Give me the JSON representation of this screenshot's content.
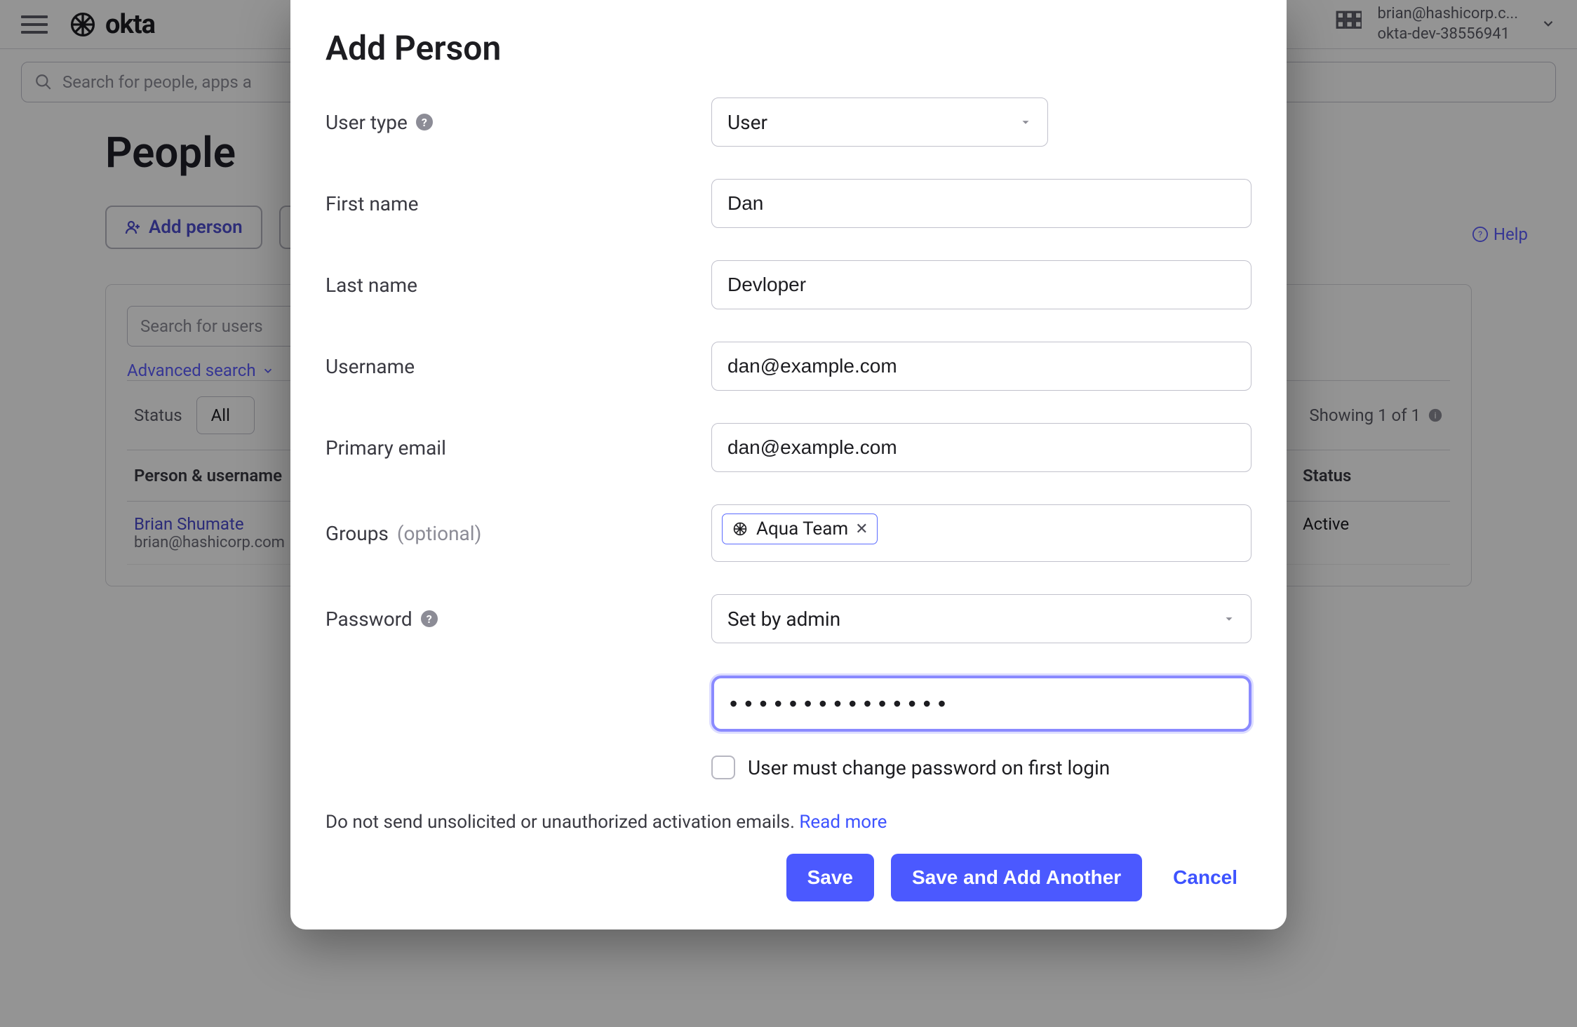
{
  "header": {
    "brand": "okta",
    "search_placeholder": "Search for people, apps a",
    "user_email_top": "brian@hashicorp.c...",
    "org_name": "okta-dev-38556941"
  },
  "page": {
    "title": "People",
    "help_label": "Help",
    "toolbar": {
      "add_person_label": "Add person"
    },
    "panel": {
      "search_placeholder": "Search for users",
      "advanced_search_label": "Advanced search",
      "status_label": "Status",
      "status_value": "All",
      "showing_text": "Showing 1 of 1",
      "columns": {
        "person": "Person & username",
        "status": "Status"
      },
      "rows": [
        {
          "name": "Brian Shumate",
          "email": "brian@hashicorp.com",
          "status": "Active"
        }
      ]
    }
  },
  "modal": {
    "title": "Add Person",
    "labels": {
      "user_type": "User type",
      "first_name": "First name",
      "last_name": "Last name",
      "username": "Username",
      "primary_email": "Primary email",
      "groups": "Groups",
      "groups_optional": "(optional)",
      "password": "Password"
    },
    "values": {
      "user_type": "User",
      "first_name": "Dan",
      "last_name": "Devloper",
      "username": "dan@example.com",
      "primary_email": "dan@example.com",
      "group_chip": "Aqua Team",
      "password_mode": "Set by admin",
      "password_value": "•••••••••••••••"
    },
    "checkbox_label": "User must change password on first login",
    "footer_text": "Do not send unsolicited or unauthorized activation emails. ",
    "footer_link": "Read more",
    "actions": {
      "save": "Save",
      "save_another": "Save and Add Another",
      "cancel": "Cancel"
    }
  }
}
